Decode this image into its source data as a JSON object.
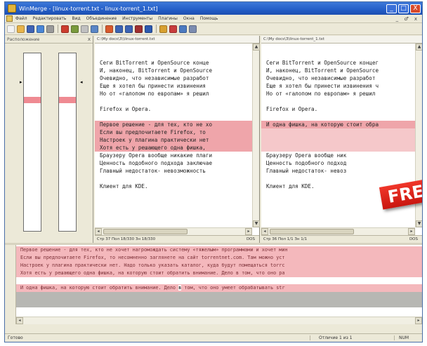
{
  "window": {
    "title": "WinMerge - [linux-torrent.txt - linux-torrent_1.txt]",
    "controls": [
      "_",
      "□",
      "X"
    ]
  },
  "menu": {
    "items": [
      "Файл",
      "Редактировать",
      "Вид",
      "Объединение",
      "Инструменты",
      "Плагины",
      "Окна",
      "Помощь"
    ],
    "window_controls": "_ ♂ x"
  },
  "toolbar": {
    "buttons": [
      {
        "icon": "new-file-icon",
        "color": "#f3f3f3"
      },
      {
        "icon": "open-folder-icon",
        "color": "#e8b44a"
      },
      {
        "icon": "save-icon",
        "color": "#3f63b5"
      },
      {
        "icon": "undo-icon",
        "color": "#4a86d6"
      },
      {
        "icon": "redo-icon",
        "color": "#9a9a9a"
      },
      {
        "icon": "next-diff-icon",
        "color": "#cc3d2e"
      },
      {
        "icon": "first-diff-icon",
        "color": "#7a9a3c"
      },
      {
        "icon": "prev-diff-icon",
        "color": "#c0c0c0"
      },
      {
        "icon": "current-diff-icon",
        "color": "#5a86c6"
      },
      {
        "icon": "last-diff-icon",
        "color": "#d95a2c"
      },
      {
        "icon": "copy-right-icon",
        "color": "#3c64b4"
      },
      {
        "icon": "copy-left-icon",
        "color": "#3c64b4"
      },
      {
        "icon": "all-right-icon",
        "color": "#a03030"
      },
      {
        "icon": "all-left-icon",
        "color": "#2c5ab0"
      },
      {
        "icon": "refresh-icon",
        "color": "#d8a030"
      },
      {
        "icon": "options-icon",
        "color": "#c83d3d"
      },
      {
        "icon": "filter-icon",
        "color": "#4c7ac0"
      },
      {
        "icon": "plugin-icon",
        "color": "#7c8cb0"
      }
    ]
  },
  "location_pane": {
    "title": "Расположение",
    "close_label": "x"
  },
  "left_doc": {
    "path": "C:\\My docs\\3\\\\linux-torrent.txt",
    "lines": [
      "",
      "",
      "Сеги BitTorrent и OpenSource конце",
      "И, наконец, BitTorrent и OpenSource",
      "Очевидно, что независимые разработ",
      "Еще я хотел бы принести извинения",
      "Но от «галопом по европам» я решил",
      "",
      "Firefox и Opera.",
      "",
      "Первое решение - для тех, кто не хо",
      "Если вы предпочитаете Firefox, то ",
      "Настроек у плагина практически нет",
      "Хотя есть у решающего одна фишка,",
      "Браузеру Opera вообще никакие плаги",
      "Ценность подобного подхода заключае",
      "Главный недостаток- невозможность ",
      "",
      "Клиент для KDE."
    ],
    "diff_rows": [
      10,
      11,
      12,
      13
    ],
    "status": "Стр 37 Пол 18/330 Зн 18/330",
    "encoding": "DOS"
  },
  "right_doc": {
    "path": "C:\\My docs\\3\\linux-torrent_1.txt",
    "lines": [
      "",
      "",
      "Сеги BitTorrent и OpenSource концег",
      "И, наконец, BitTorrent и OpenSource",
      "Очевидно, что независимые разработ",
      "Еще я хотел бы принести извинения ч",
      "Но от «галопом по европам» я решил",
      "",
      "Firefox и Opera.",
      "",
      "И одна фишка, на которую стоит обра",
      "",
      "",
      "",
      "Браузеру Opera вообще ник",
      "Ценность подобного подход",
      "Главный недостаток- невоз",
      "",
      "Клиент для KDE."
    ],
    "diff_rows": [
      10
    ],
    "blank_diff_rows": [
      11,
      12,
      13
    ],
    "status": "Стр 36 Пол 1/1 Зн 1/1",
    "encoding": "DOS"
  },
  "badge": {
    "text": "FREE"
  },
  "diff_pane": {
    "top_lines": [
      "Первое решение - для тех, кто не хочет нагромождать систему «тяжелым» программами и хочет мин",
      "Если вы предпочитаете Firefox, то несомненно заглянете на сайт torrentnet.com. Там можно уст",
      "Настроек у плагина практически нет. Надо только указать каталог, куда будут помещаться torrc",
      "Хотя есть у решающего одна фишка, на которую стоит обратить внимание. Дело в том, что оно ра"
    ],
    "bottom_line_before": "И одна фишка, на которую стоит обратить внимание. Дело ",
    "bottom_highlight": "в",
    "bottom_line_after": " том, что оно умеет обрабатывать str"
  },
  "statusbar": {
    "left": "Готово",
    "mid": "Отличие 1 из 1",
    "right": "NUM"
  }
}
